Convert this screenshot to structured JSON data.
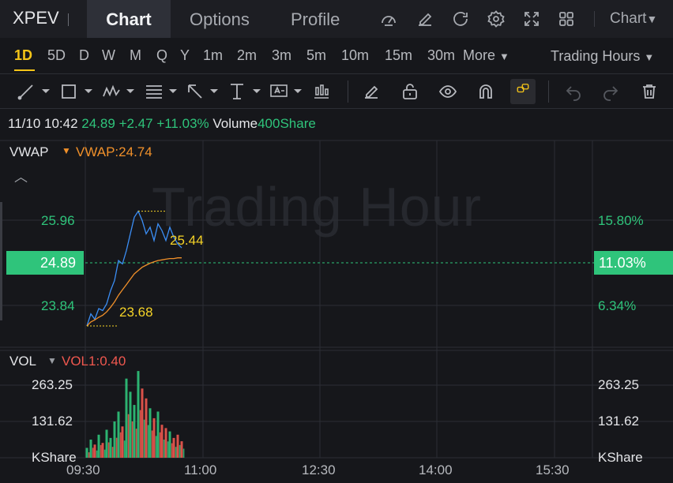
{
  "header": {
    "ticker": "XPEV",
    "tabs": [
      {
        "label": "Chart",
        "active": true
      },
      {
        "label": "Options",
        "active": false
      },
      {
        "label": "Profile",
        "active": false
      }
    ],
    "icons": [
      "gauge-icon",
      "edit-icon",
      "refresh-icon",
      "settings-icon",
      "fullscreen-icon",
      "layout-grid-icon"
    ],
    "chart_type_label": "Chart"
  },
  "periods": {
    "items": [
      "1D",
      "5D",
      "D",
      "W",
      "M",
      "Q",
      "Y",
      "1m",
      "2m",
      "3m",
      "5m",
      "10m",
      "15m",
      "30m"
    ],
    "active": "1D",
    "more_label": "More",
    "session_label": "Trading Hours"
  },
  "drawing_tools": [
    "trend-line-icon",
    "rectangle-icon",
    "pattern-icon",
    "fibonacci-icon",
    "arrow-icon",
    "vertical-line-icon",
    "text-icon",
    "candles-icon",
    "pencil-icon",
    "unlock-icon",
    "eye-icon",
    "magnet-icon",
    "link-icon",
    "undo-icon",
    "redo-icon",
    "trash-icon"
  ],
  "info": {
    "datetime": "11/10 10:42",
    "price": "24.89",
    "change": "+2.47",
    "change_pct": "+11.03%",
    "volume_label": "Volume",
    "volume_value": "400Share"
  },
  "main_panel": {
    "indicator": "VWAP",
    "indicator_value": "VWAP:24.74",
    "watermark": "Trading Hour",
    "price_levels": [
      "25.96",
      "23.84"
    ],
    "current_price": "24.89",
    "pct_levels": [
      "15.80%",
      "6.34%"
    ],
    "current_pct": "11.03%",
    "high_label": "25.44",
    "low_label": "23.68"
  },
  "volume_panel": {
    "indicator": "VOL",
    "indicator_value": "VOL1:0.40",
    "levels_left": [
      "263.25",
      "131.62",
      "KShare"
    ],
    "levels_right": [
      "263.25",
      "131.62",
      "KShare"
    ]
  },
  "time_axis": [
    "09:30",
    "11:00",
    "12:30",
    "14:00",
    "15:30"
  ],
  "colors": {
    "up": "#2fc47b",
    "down": "#f0584f",
    "price_line": "#3b8ef5",
    "vwap_line": "#f0902a",
    "accent": "#f5c518"
  },
  "chart_data": {
    "type": "line",
    "x": [
      "09:30",
      "09:33",
      "09:36",
      "09:39",
      "09:42",
      "09:45",
      "09:48",
      "09:51",
      "09:54",
      "09:57",
      "10:00",
      "10:03",
      "10:06",
      "10:09",
      "10:12",
      "10:15",
      "10:18",
      "10:21",
      "10:24",
      "10:27",
      "10:30",
      "10:33",
      "10:36",
      "10:39",
      "10:42"
    ],
    "series": [
      {
        "values": [
          23.72,
          23.9,
          23.82,
          23.98,
          23.95,
          24.05,
          24.25,
          24.4,
          24.7,
          24.65,
          24.85,
          25.1,
          25.35,
          25.44,
          25.3,
          25.1,
          25.2,
          25.0,
          25.25,
          25.15,
          25.0,
          25.2,
          25.05,
          24.95,
          24.89
        ]
      },
      {
        "values": [
          23.72,
          23.78,
          23.81,
          23.85,
          23.88,
          23.93,
          24.0,
          24.08,
          24.18,
          24.26,
          24.34,
          24.42,
          24.5,
          24.55,
          24.6,
          24.63,
          24.66,
          24.68,
          24.7,
          24.71,
          24.72,
          24.73,
          24.73,
          24.74,
          24.74
        ]
      }
    ],
    "volume": [
      30,
      55,
      40,
      70,
      45,
      85,
      60,
      110,
      140,
      95,
      240,
      200,
      160,
      263,
      210,
      180,
      150,
      120,
      140,
      100,
      90,
      80,
      60,
      70,
      50
    ],
    "ylim": [
      23.4,
      26.5
    ],
    "vol_ylim": [
      0,
      263.25
    ]
  }
}
